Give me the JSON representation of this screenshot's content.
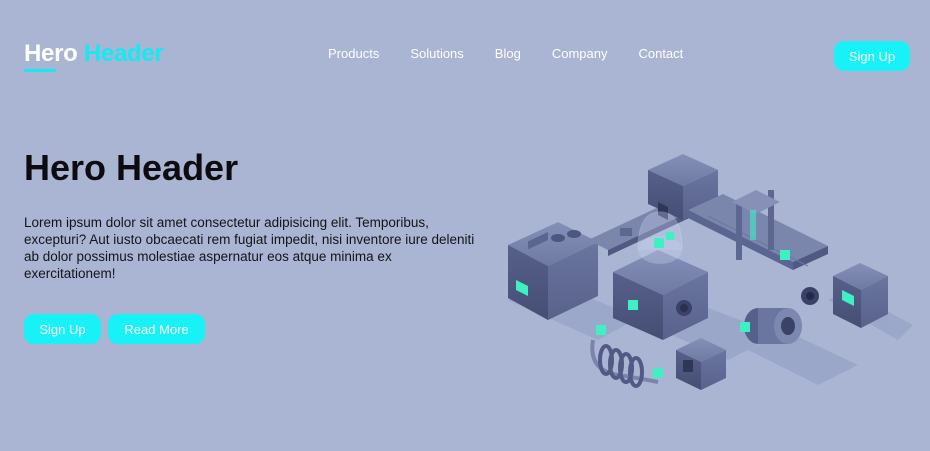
{
  "brand": {
    "logo_word1": "Hero",
    "logo_word2": "Header",
    "accent_color": "#14eaf2"
  },
  "nav": {
    "items": [
      {
        "label": "Products"
      },
      {
        "label": "Solutions"
      },
      {
        "label": "Blog"
      },
      {
        "label": "Company"
      },
      {
        "label": "Contact"
      }
    ],
    "signup_label": "Sign Up"
  },
  "hero": {
    "title": "Hero Header",
    "text": "Lorem ipsum dolor sit amet consectetur adipisicing elit. Temporibus, excepturi? Aut iusto obcaecati rem fugiat impedit, nisi inventore iure deleniti ab dolor possimus molestiae aspernatur eos atque minima ex exercitationem!",
    "primary_button": "Sign Up",
    "secondary_button": "Read More"
  },
  "illustration": {
    "icon": "isometric-factory-illustration",
    "glow_color": "#3ff0c2"
  }
}
